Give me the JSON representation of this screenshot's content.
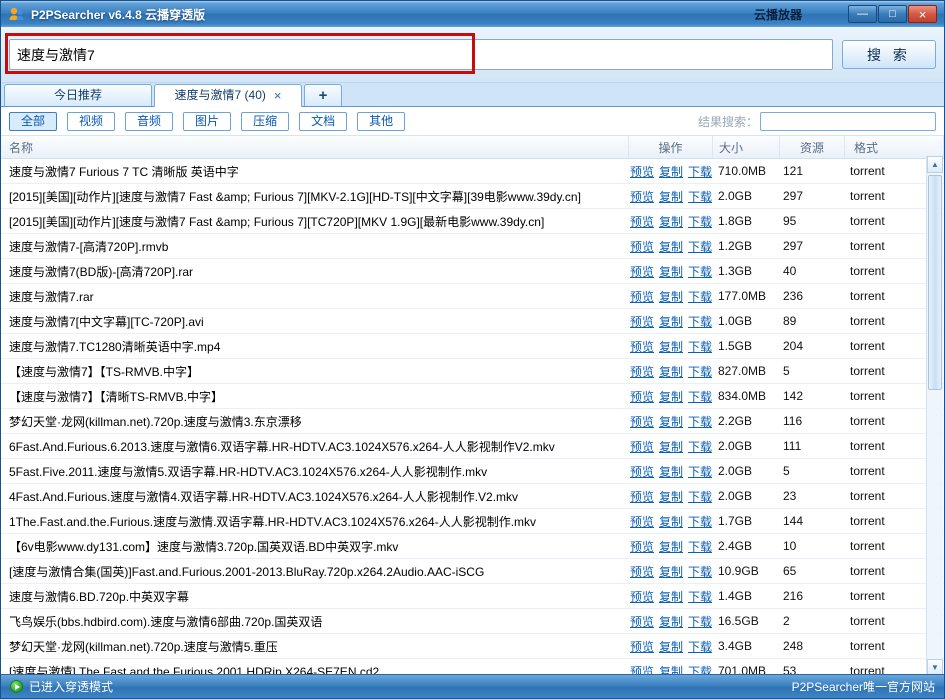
{
  "window": {
    "title": "P2PSearcher v6.4.8 云播穿透版",
    "cloud_player_label": "云播放器",
    "controls": {
      "minimize": "—",
      "maximize": "□",
      "close": "×"
    }
  },
  "search": {
    "query": "速度与激情7",
    "button_label": "搜 索"
  },
  "tabs": {
    "recommend": "今日推荐",
    "active": "速度与激情7 (40)",
    "close_glyph": "×",
    "new_tab": "+"
  },
  "filters": [
    "全部",
    "视频",
    "音频",
    "图片",
    "压缩",
    "文档",
    "其他"
  ],
  "result_filter": {
    "label": "结果搜索：",
    "value": ""
  },
  "table": {
    "headers": {
      "name": "名称",
      "action": "操作",
      "size": "大小",
      "seeds": "资源",
      "format": "格式"
    },
    "action_links": [
      "预览",
      "复制",
      "下载"
    ],
    "rows": [
      {
        "name": "速度与激情7 Furious 7 TC 清晰版 英语中字",
        "size": "710.0MB",
        "seeds": "121",
        "format": "torrent"
      },
      {
        "name": "[2015][美国][动作片][速度与激情7 Fast &amp; Furious 7][MKV-2.1G][HD-TS][中文字幕][39电影www.39dy.cn]",
        "size": "2.0GB",
        "seeds": "297",
        "format": "torrent"
      },
      {
        "name": "[2015][美国][动作片][速度与激情7 Fast &amp; Furious 7][TC720P][MKV 1.9G][最新电影www.39dy.cn]",
        "size": "1.8GB",
        "seeds": "95",
        "format": "torrent"
      },
      {
        "name": "速度与激情7-[高清720P].rmvb",
        "size": "1.2GB",
        "seeds": "297",
        "format": "torrent"
      },
      {
        "name": "速度与激情7(BD版)-[高清720P].rar",
        "size": "1.3GB",
        "seeds": "40",
        "format": "torrent"
      },
      {
        "name": "速度与激情7.rar",
        "size": "177.0MB",
        "seeds": "236",
        "format": "torrent"
      },
      {
        "name": "速度与激情7[中文字幕][TC-720P].avi",
        "size": "1.0GB",
        "seeds": "89",
        "format": "torrent"
      },
      {
        "name": "速度与激情7.TC1280清晰英语中字.mp4",
        "size": "1.5GB",
        "seeds": "204",
        "format": "torrent"
      },
      {
        "name": "【速度与激情7】【TS-RMVB.中字】",
        "size": "827.0MB",
        "seeds": "5",
        "format": "torrent"
      },
      {
        "name": "【速度与激情7】【清晰TS-RMVB.中字】",
        "size": "834.0MB",
        "seeds": "142",
        "format": "torrent"
      },
      {
        "name": "梦幻天堂·龙网(killman.net).720p.速度与激情3.东京漂移",
        "size": "2.2GB",
        "seeds": "116",
        "format": "torrent"
      },
      {
        "name": "6Fast.And.Furious.6.2013.速度与激情6.双语字幕.HR-HDTV.AC3.1024X576.x264-人人影视制作V2.mkv",
        "size": "2.0GB",
        "seeds": "111",
        "format": "torrent"
      },
      {
        "name": "5Fast.Five.2011.速度与激情5.双语字幕.HR-HDTV.AC3.1024X576.x264-人人影视制作.mkv",
        "size": "2.0GB",
        "seeds": "5",
        "format": "torrent"
      },
      {
        "name": "4Fast.And.Furious.速度与激情4.双语字幕.HR-HDTV.AC3.1024X576.x264-人人影视制作.V2.mkv",
        "size": "2.0GB",
        "seeds": "23",
        "format": "torrent"
      },
      {
        "name": "1The.Fast.and.the.Furious.速度与激情.双语字幕.HR-HDTV.AC3.1024X576.x264-人人影视制作.mkv",
        "size": "1.7GB",
        "seeds": "144",
        "format": "torrent"
      },
      {
        "name": "【6v电影www.dy131.com】速度与激情3.720p.国英双语.BD中英双字.mkv",
        "size": "2.4GB",
        "seeds": "10",
        "format": "torrent"
      },
      {
        "name": "[速度与激情合集(国英)]Fast.and.Furious.2001-2013.BluRay.720p.x264.2Audio.AAC-iSCG",
        "size": "10.9GB",
        "seeds": "65",
        "format": "torrent"
      },
      {
        "name": "速度与激情6.BD.720p.中英双字幕",
        "size": "1.4GB",
        "seeds": "216",
        "format": "torrent"
      },
      {
        "name": "飞鸟娱乐(bbs.hdbird.com).速度与激情6部曲.720p.国英双语",
        "size": "16.5GB",
        "seeds": "2",
        "format": "torrent"
      },
      {
        "name": "梦幻天堂·龙网(killman.net).720p.速度与激情5.重压",
        "size": "3.4GB",
        "seeds": "248",
        "format": "torrent"
      },
      {
        "name": "[速度与激情].The.Fast.and.the.Furious.2001.HDRip.X264-SE7EN.cd2",
        "size": "701.0MB",
        "seeds": "53",
        "format": "torrent"
      }
    ]
  },
  "scrollbar": {
    "up": "▲",
    "down": "▼"
  },
  "status_bar": {
    "left": "已进入穿透模式",
    "right": "P2PSearcher唯一官方网站"
  }
}
